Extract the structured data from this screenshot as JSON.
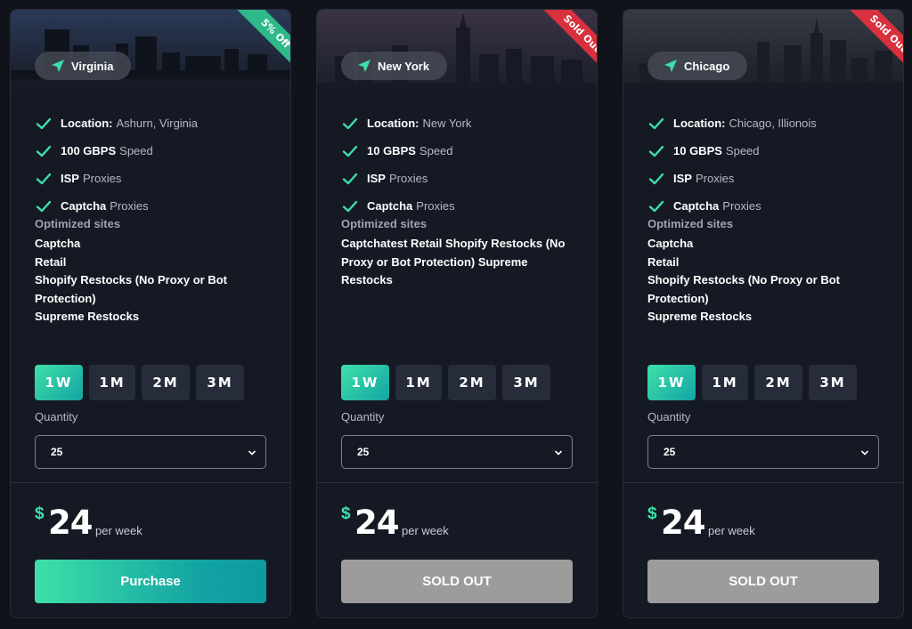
{
  "cards": [
    {
      "location_name": "Virginia",
      "ribbon": "5% Off",
      "ribbon_color": "#2fb98a",
      "features": [
        {
          "strong": "Location:",
          "muted": "Ashurn, Virginia"
        },
        {
          "strong": "100 GBPS",
          "muted": "Speed"
        },
        {
          "strong": "ISP",
          "muted": "Proxies"
        },
        {
          "strong": "Captcha",
          "muted": "Proxies"
        }
      ],
      "optimized_title": "Optimized sites",
      "sites": [
        "Captcha",
        "Retail",
        "Shopify Restocks (No Proxy or Bot Protection)",
        "Supreme Restocks"
      ],
      "terms": [
        "1W",
        "1M",
        "2M",
        "3M"
      ],
      "selected_term": "1W",
      "quantity_label": "Quantity",
      "quantity_value": "25",
      "price_currency": "$",
      "price_amount": "24",
      "price_period": "per week",
      "cta_label": "Purchase",
      "cta_state": "active"
    },
    {
      "location_name": "New York",
      "ribbon": "Sold Out",
      "ribbon_color": "#d8303d",
      "features": [
        {
          "strong": "Location:",
          "muted": "New York"
        },
        {
          "strong": "10 GBPS",
          "muted": "Speed"
        },
        {
          "strong": "ISP",
          "muted": "Proxies"
        },
        {
          "strong": "Captcha",
          "muted": "Proxies"
        }
      ],
      "optimized_title": "Optimized sites",
      "sites": [
        "Captchatest Retail Shopify Restocks (No Proxy or Bot Protection) Supreme Restocks"
      ],
      "terms": [
        "1W",
        "1M",
        "2M",
        "3M"
      ],
      "selected_term": "1W",
      "quantity_label": "Quantity",
      "quantity_value": "25",
      "price_currency": "$",
      "price_amount": "24",
      "price_period": "per week",
      "cta_label": "SOLD OUT",
      "cta_state": "disabled"
    },
    {
      "location_name": "Chicago",
      "ribbon": "Sold Out",
      "ribbon_color": "#d8303d",
      "features": [
        {
          "strong": "Location:",
          "muted": "Chicago, Illionois"
        },
        {
          "strong": "10 GBPS",
          "muted": "Speed"
        },
        {
          "strong": "ISP",
          "muted": "Proxies"
        },
        {
          "strong": "Captcha",
          "muted": "Proxies"
        }
      ],
      "optimized_title": "Optimized sites",
      "sites": [
        "Captcha",
        "Retail",
        "Shopify Restocks (No Proxy or Bot Protection)",
        "Supreme Restocks"
      ],
      "terms": [
        "1W",
        "1M",
        "2M",
        "3M"
      ],
      "selected_term": "1W",
      "quantity_label": "Quantity",
      "quantity_value": "25",
      "price_currency": "$",
      "price_amount": "24",
      "price_period": "per week",
      "cta_label": "SOLD OUT",
      "cta_state": "disabled"
    }
  ],
  "colors": {
    "accent": "#3ee0a8",
    "accent_dark": "#14a4a4",
    "sold_out_button": "#9c9c9c",
    "background": "#101319",
    "card": "#151924"
  },
  "icons": {
    "location": "navigation-arrow-icon",
    "feature": "check-icon",
    "select": "chevron-down-icon"
  }
}
